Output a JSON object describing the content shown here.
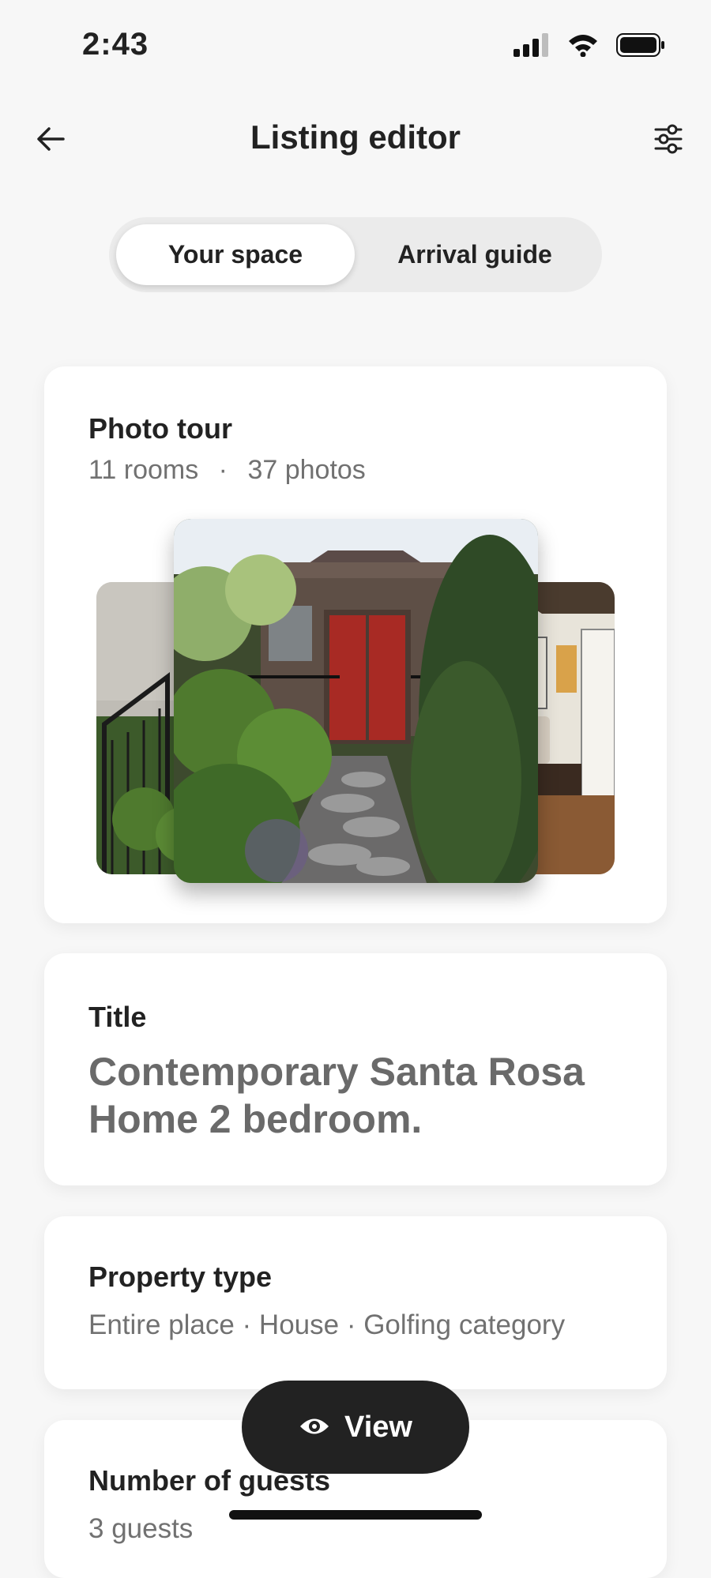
{
  "status": {
    "time": "2:43"
  },
  "nav": {
    "title": "Listing editor"
  },
  "tabs": {
    "active": "Your space",
    "inactive": "Arrival guide"
  },
  "photo_tour": {
    "label": "Photo tour",
    "rooms": "11 rooms",
    "separator": "·",
    "photos": "37 photos"
  },
  "title_card": {
    "label": "Title",
    "value": "Contemporary Santa Rosa Home 2 bedroom."
  },
  "property_type": {
    "label": "Property type",
    "value": "Entire place · House · Golfing category"
  },
  "guests": {
    "label": "Number of guests",
    "value": "3 guests"
  },
  "view_button": {
    "label": "View",
    "icon": "eye-icon"
  },
  "colors": {
    "accent": "#222222",
    "muted": "#717171",
    "background": "#f7f7f7"
  }
}
